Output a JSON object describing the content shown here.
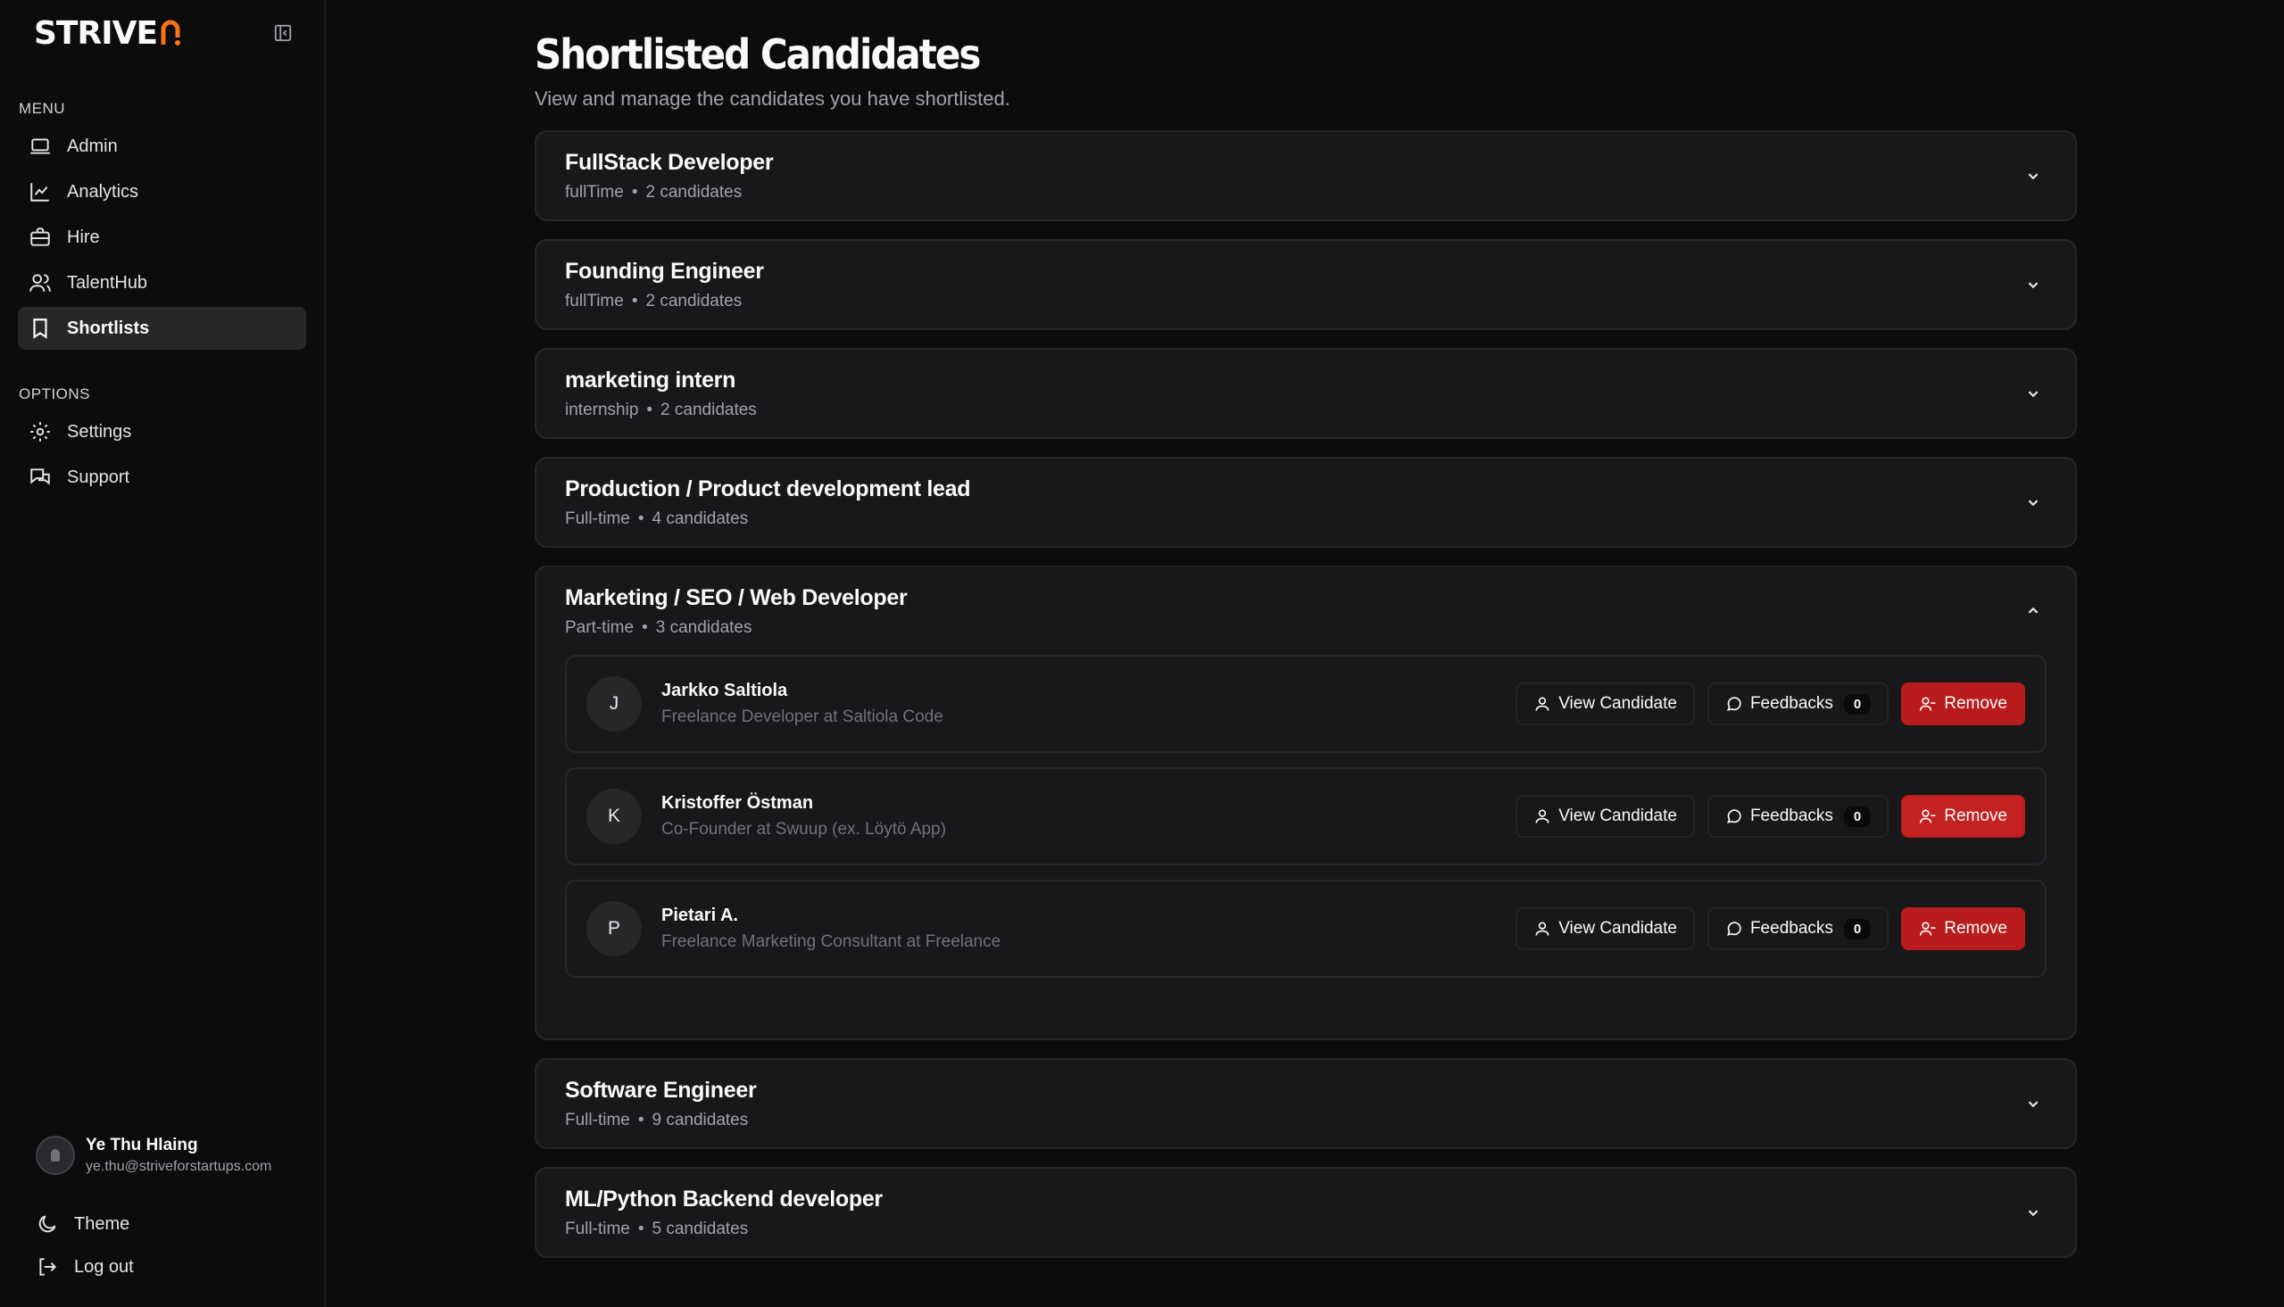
{
  "brand": {
    "name": "STRIVE"
  },
  "sidebar": {
    "menu_label": "MENU",
    "menu_items": [
      {
        "label": "Admin",
        "icon": "laptop-icon"
      },
      {
        "label": "Analytics",
        "icon": "chart-line-icon"
      },
      {
        "label": "Hire",
        "icon": "briefcase-icon"
      },
      {
        "label": "TalentHub",
        "icon": "users-icon"
      },
      {
        "label": "Shortlists",
        "icon": "bookmark-icon",
        "active": true
      }
    ],
    "options_label": "OPTIONS",
    "option_items": [
      {
        "label": "Settings",
        "icon": "gear-icon"
      },
      {
        "label": "Support",
        "icon": "chat-icon"
      }
    ],
    "user": {
      "name": "Ye Thu Hlaing",
      "email": "ye.thu@striveforstartups.com"
    },
    "theme_label": "Theme",
    "logout_label": "Log out"
  },
  "page": {
    "title": "Shortlisted Candidates",
    "subtitle": "View and manage the candidates you have shortlisted."
  },
  "jobs": [
    {
      "title": "FullStack Developer",
      "type": "fullTime",
      "count": "2 candidates",
      "expanded": false
    },
    {
      "title": "Founding Engineer",
      "type": "fullTime",
      "count": "2 candidates",
      "expanded": false
    },
    {
      "title": "marketing intern",
      "type": "internship",
      "count": "2 candidates",
      "expanded": false
    },
    {
      "title": "Production / Product development lead",
      "type": "Full-time",
      "count": "4 candidates",
      "expanded": false
    },
    {
      "title": "Marketing / SEO / Web Developer",
      "type": "Part-time",
      "count": "3 candidates",
      "expanded": true
    },
    {
      "title": "Software Engineer",
      "type": "Full-time",
      "count": "9 candidates",
      "expanded": false
    },
    {
      "title": "ML/Python Backend developer",
      "type": "Full-time",
      "count": "5 candidates",
      "expanded": false
    }
  ],
  "candidates": [
    {
      "initial": "J",
      "name": "Jarkko Saltiola",
      "role": "Freelance Developer at Saltiola Code",
      "feedbacks": "0"
    },
    {
      "initial": "K",
      "name": "Kristoffer Östman",
      "role": "Co-Founder at Swuup (ex. Löytö App)",
      "feedbacks": "0"
    },
    {
      "initial": "P",
      "name": "Pietari A.",
      "role": "Freelance Marketing Consultant at Freelance",
      "feedbacks": "0"
    }
  ],
  "actions": {
    "view_label": "View Candidate",
    "feedbacks_label": "Feedbacks",
    "remove_label": "Remove"
  },
  "colors": {
    "accent": "#f97316",
    "danger": "#b91c1c",
    "background": "#0c0c0d",
    "card": "#18181b"
  }
}
